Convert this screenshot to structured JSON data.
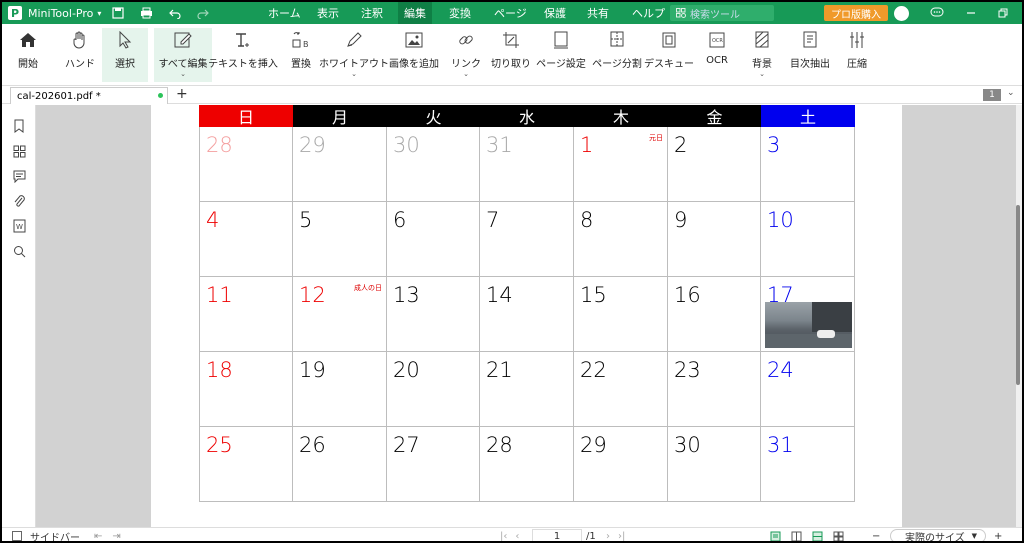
{
  "titlebar": {
    "app_name": "MiniTool-Pro",
    "menus": [
      "ホーム",
      "表示",
      "注釈",
      "編集",
      "変換",
      "ページ",
      "保護",
      "共有",
      "ヘルプ"
    ],
    "active_menu": "編集",
    "search_placeholder": "検索ツール",
    "buy_label": "プロ版購入"
  },
  "ribbon": {
    "tools": [
      {
        "label": "開始",
        "icon": "home-icon"
      },
      {
        "label": "ハンド",
        "icon": "hand-icon"
      },
      {
        "label": "選択",
        "icon": "cursor-icon"
      },
      {
        "label": "すべて編集",
        "icon": "edit-all-icon"
      },
      {
        "label": "テキストを挿入",
        "icon": "text-insert-icon"
      },
      {
        "label": "置換",
        "icon": "replace-icon"
      },
      {
        "label": "ホワイトアウト",
        "icon": "whiteout-icon"
      },
      {
        "label": "画像を追加",
        "icon": "image-add-icon"
      },
      {
        "label": "リンク",
        "icon": "link-icon"
      },
      {
        "label": "切り取り",
        "icon": "crop-icon"
      },
      {
        "label": "ページ設定",
        "icon": "page-setup-icon"
      },
      {
        "label": "ページ分割",
        "icon": "page-split-icon"
      },
      {
        "label": "デスキュー",
        "icon": "deskew-icon"
      },
      {
        "label": "OCR",
        "icon": "ocr-icon"
      },
      {
        "label": "背景",
        "icon": "background-icon"
      },
      {
        "label": "目次抽出",
        "icon": "toc-extract-icon"
      },
      {
        "label": "圧縮",
        "icon": "compress-icon"
      }
    ]
  },
  "tabs": {
    "doc_name": "cal-202601.pdf *",
    "page_count_badge": "1"
  },
  "calendar": {
    "weekdays": [
      "日",
      "月",
      "火",
      "水",
      "木",
      "金",
      "土"
    ],
    "weekday_colors": [
      "#ee0000",
      "#000000",
      "#000000",
      "#000000",
      "#000000",
      "#000000",
      "#0000ee"
    ],
    "weeks": [
      [
        {
          "d": "28",
          "c": "#f4a0a0"
        },
        {
          "d": "29",
          "c": "#a8a8a8"
        },
        {
          "d": "30",
          "c": "#a8a8a8"
        },
        {
          "d": "31",
          "c": "#a8a8a8"
        },
        {
          "d": "1",
          "c": "#ee0000",
          "note": "元日"
        },
        {
          "d": "2",
          "c": "#000000"
        },
        {
          "d": "3",
          "c": "#0000ee"
        }
      ],
      [
        {
          "d": "4",
          "c": "#ee0000"
        },
        {
          "d": "5",
          "c": "#000000"
        },
        {
          "d": "6",
          "c": "#000000"
        },
        {
          "d": "7",
          "c": "#000000"
        },
        {
          "d": "8",
          "c": "#000000"
        },
        {
          "d": "9",
          "c": "#000000"
        },
        {
          "d": "10",
          "c": "#0000ee"
        }
      ],
      [
        {
          "d": "11",
          "c": "#ee0000"
        },
        {
          "d": "12",
          "c": "#ee0000",
          "note": "成人の日"
        },
        {
          "d": "13",
          "c": "#000000"
        },
        {
          "d": "14",
          "c": "#000000"
        },
        {
          "d": "15",
          "c": "#000000"
        },
        {
          "d": "16",
          "c": "#000000"
        },
        {
          "d": "17",
          "c": "#0000ee",
          "photo": true
        }
      ],
      [
        {
          "d": "18",
          "c": "#ee0000"
        },
        {
          "d": "19",
          "c": "#000000"
        },
        {
          "d": "20",
          "c": "#000000"
        },
        {
          "d": "21",
          "c": "#000000"
        },
        {
          "d": "22",
          "c": "#000000"
        },
        {
          "d": "23",
          "c": "#000000"
        },
        {
          "d": "24",
          "c": "#0000ee"
        }
      ],
      [
        {
          "d": "25",
          "c": "#ee0000"
        },
        {
          "d": "26",
          "c": "#000000"
        },
        {
          "d": "27",
          "c": "#000000"
        },
        {
          "d": "28",
          "c": "#000000"
        },
        {
          "d": "29",
          "c": "#000000"
        },
        {
          "d": "30",
          "c": "#000000"
        },
        {
          "d": "31",
          "c": "#0000ee"
        }
      ]
    ]
  },
  "statusbar": {
    "sidebar_label": "サイドバー",
    "page_current": "1",
    "page_total": "/1",
    "zoom_label": "実際のサイズ"
  },
  "colors": {
    "brand": "#179a57",
    "buy": "#f09a2a"
  }
}
